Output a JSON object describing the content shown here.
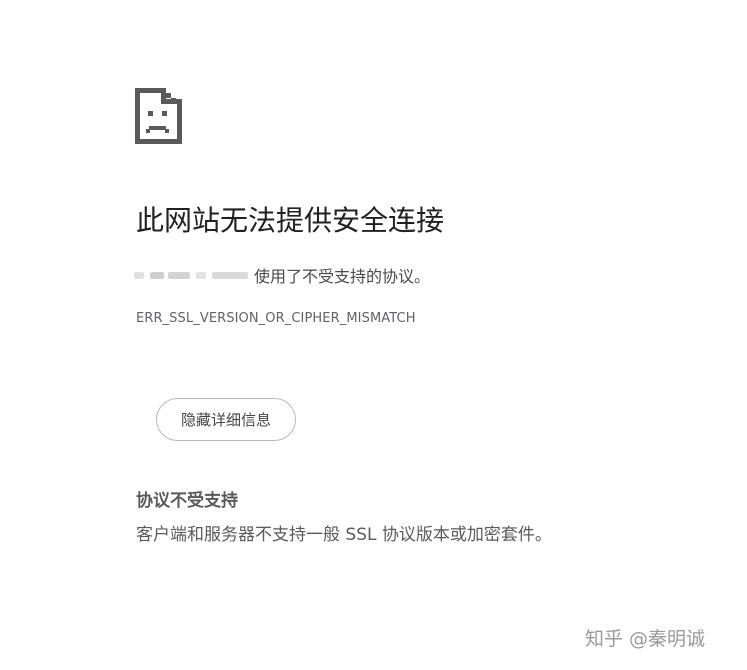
{
  "page": {
    "title": "此网站无法提供安全连接",
    "summary_suffix": "使用了不受支持的协议。",
    "error_code": "ERR_SSL_VERSION_OR_CIPHER_MISMATCH",
    "details_button_label": "隐藏详细信息",
    "details_heading": "协议不受支持",
    "details_text": "客户端和服务器不支持一般 SSL 协议版本或加密套件。"
  },
  "icons": {
    "error": "sad-page-icon"
  },
  "watermark": {
    "text": "知乎 @秦明诚"
  },
  "colors": {
    "title": "#202124",
    "icon": "#5a5a5a",
    "error_code": "#5f6368",
    "button_border": "#b9b9b9"
  }
}
